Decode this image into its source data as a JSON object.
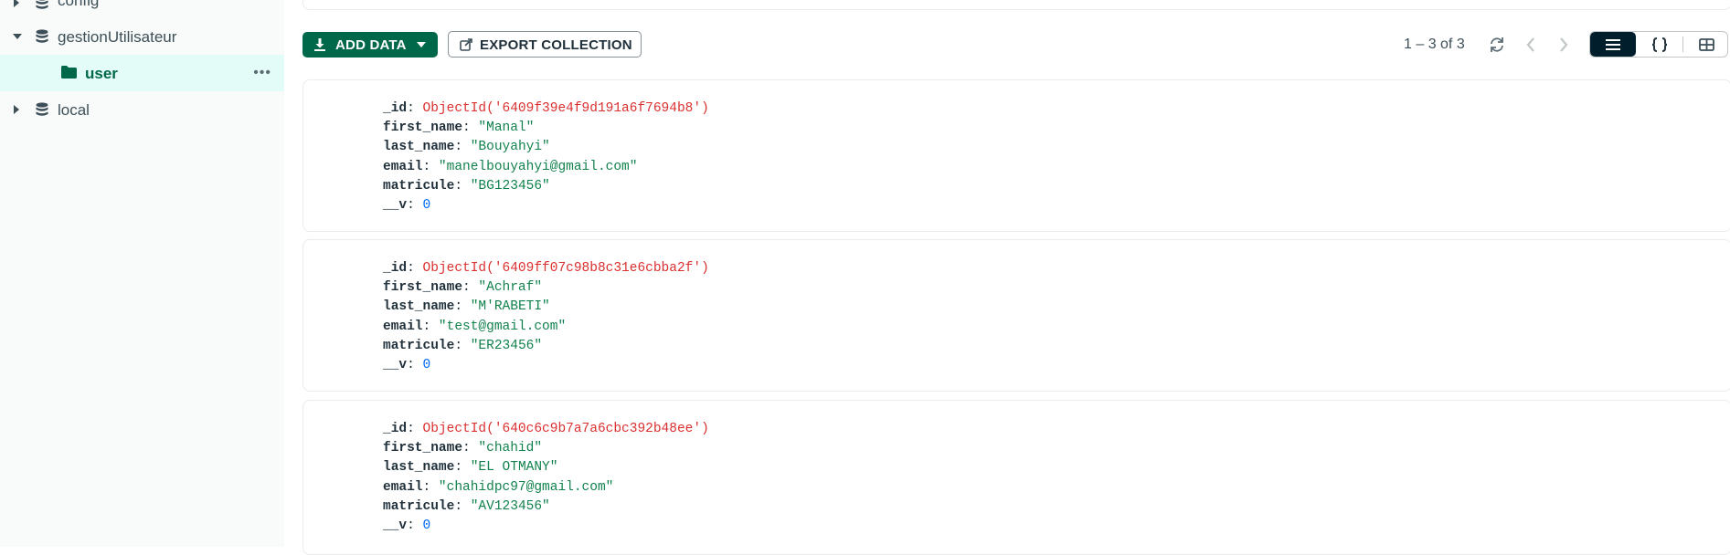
{
  "sidebar": {
    "items": [
      {
        "label": "config",
        "icon": "database-icon"
      },
      {
        "label": "gestionUtilisateur",
        "icon": "database-icon"
      },
      {
        "label": "user",
        "icon": "folder-icon",
        "more": "•••"
      },
      {
        "label": "local",
        "icon": "database-icon"
      }
    ]
  },
  "toolbar": {
    "add_data_label": "ADD DATA",
    "export_label": "EXPORT COLLECTION",
    "pagination": "1 – 3 of 3"
  },
  "documents": [
    {
      "fields": [
        {
          "key": "_id",
          "value": "ObjectId('6409f39e4f9d191a6f7694b8')"
        },
        {
          "key": "first_name",
          "value": "\"Manal\""
        },
        {
          "key": "last_name",
          "value": "\"Bouyahyi\""
        },
        {
          "key": "email",
          "value": "\"manelbouyahyi@gmail.com\""
        },
        {
          "key": "matricule",
          "value": "\"BG123456\""
        },
        {
          "key": "__v",
          "value": "0"
        }
      ]
    },
    {
      "fields": [
        {
          "key": "_id",
          "value": "ObjectId('6409ff07c98b8c31e6cbba2f')"
        },
        {
          "key": "first_name",
          "value": "\"Achraf\""
        },
        {
          "key": "last_name",
          "value": "\"M'RABETI\""
        },
        {
          "key": "email",
          "value": "\"test@gmail.com\""
        },
        {
          "key": "matricule",
          "value": "\"ER23456\""
        },
        {
          "key": "__v",
          "value": "0"
        }
      ]
    },
    {
      "fields": [
        {
          "key": "_id",
          "value": "ObjectId('640c6c9b7a7a6cbc392b48ee')"
        },
        {
          "key": "first_name",
          "value": "\"chahid\""
        },
        {
          "key": "last_name",
          "value": "\"EL OTMANY\""
        },
        {
          "key": "email",
          "value": "\"chahidpc97@gmail.com\""
        },
        {
          "key": "matricule",
          "value": "\"AV123456\""
        },
        {
          "key": "__v",
          "value": "0"
        }
      ]
    }
  ],
  "colors": {
    "brand_green": "#00684a",
    "selected_bg": "#e3fcf7",
    "objectid": "#db3030",
    "string": "#12824d",
    "number": "#016bf8",
    "active_view": "#001e2b"
  },
  "icons": [
    "download-icon",
    "chevron-down-icon",
    "export-icon",
    "refresh-icon",
    "chevron-left-icon",
    "chevron-right-icon",
    "list-view-icon",
    "json-view-icon",
    "table-view-icon"
  ]
}
